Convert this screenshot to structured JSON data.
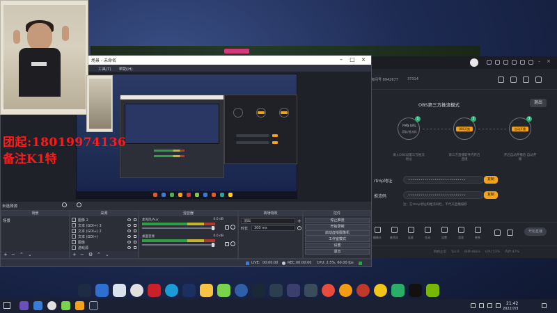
{
  "background": {
    "accent": "#2b3a66"
  },
  "stream_tool": {
    "stats": [
      "房间号 8942677",
      "37314"
    ],
    "obs_mode_title": "OBS第三方推流模式",
    "exit_label": "退出",
    "steps": [
      {
        "num": "1",
        "label": "FMS URL",
        "sub": "获取/推流码",
        "caption": "填入OBS设置三方推流地址"
      },
      {
        "num": "2",
        "label": "OBS开推",
        "sub": "",
        "caption": "第三方直播软件内开启直播"
      },
      {
        "num": "3",
        "label": "自动开播",
        "sub": "",
        "caption": "开启自动开播后\n自动开播"
      }
    ],
    "rtmp_label": "rtmp地址",
    "rtmp_value": "••••••••••••••••••••••••••••",
    "rtmp_copy": "复制",
    "key_label": "推流码",
    "key_value": "••••••••••••••••••••••••••••",
    "key_copy": "复制",
    "hint": "注：在rtmp地址和推流码栏，不代天直播偏移",
    "toolbar": [
      "摄像头",
      "麦克风",
      "连麦",
      "互动",
      "设置",
      "游戏",
      "更多"
    ],
    "start_live": "开始直播",
    "status_line": "网络正常 fps:0 码率:0kb/s CPU:51% 内存:47%"
  },
  "obs": {
    "title": "场景 - 未命名",
    "menu": [
      "工具(T)",
      "帮助(H)"
    ],
    "status_label": "未选择源",
    "docks": {
      "scenes": "场景",
      "sources": "来源",
      "mixer": "混音器",
      "transition": "转场特效",
      "controls": "控件"
    },
    "scene_item": "场景",
    "sources": [
      {
        "name": "图像 2"
      },
      {
        "name": "文本 (GDI+) 3"
      },
      {
        "name": "文本 (GDI+) 2"
      },
      {
        "name": "文本 (GDI+)"
      },
      {
        "name": "图像"
      },
      {
        "name": "游戏源"
      }
    ],
    "mixer": [
      {
        "name": "麦克风/Aux",
        "db": "0.0 dB"
      },
      {
        "name": "桌面音频",
        "db": "0.0 dB"
      }
    ],
    "transition": {
      "selected": "淡出",
      "duration_label": "时长",
      "duration_value": "300 ms"
    },
    "controls": [
      "停止推流",
      "开始录制",
      "启动虚拟摄像机",
      "工作室模式",
      "设置",
      "退出"
    ],
    "statusbar": {
      "live_label": "LIVE:",
      "live_time": "00:00:00",
      "rec_label": "REC:",
      "rec_time": "00:00:00",
      "cpu": "CPU: 2.5%, 60.00 fps"
    }
  },
  "overlay": {
    "phone": "团起:18019974136",
    "note": "备注K1特"
  },
  "taskbar": {
    "time": "21:42",
    "date": "2022/7/3"
  }
}
